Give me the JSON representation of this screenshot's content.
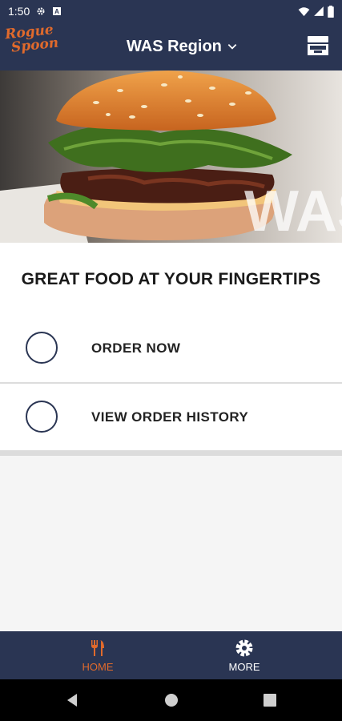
{
  "status_bar": {
    "time": "1:50",
    "icons": [
      "gear-icon",
      "a-icon",
      "wifi-icon",
      "signal-icon",
      "battery-icon"
    ]
  },
  "header": {
    "logo_line1": "Rogue",
    "logo_line2": "Spoon",
    "region_label": "WAS Region",
    "region_icon": "chevron-down-icon",
    "right_icon": "tray-icon"
  },
  "hero": {
    "overlay_text": "WAS"
  },
  "main": {
    "tagline": "GREAT FOOD AT YOUR FINGERTIPS",
    "actions": [
      {
        "label": "ORDER NOW"
      },
      {
        "label": "VIEW ORDER HISTORY"
      }
    ]
  },
  "bottom_nav": {
    "tabs": [
      {
        "label": "HOME",
        "icon": "utensils-icon",
        "active": true
      },
      {
        "label": "MORE",
        "icon": "gear-icon",
        "active": false
      }
    ]
  },
  "colors": {
    "brand_navy": "#2a3553",
    "accent_orange": "#e06a2c",
    "card_bg": "#ffffff",
    "page_bg": "#f5f5f5"
  }
}
